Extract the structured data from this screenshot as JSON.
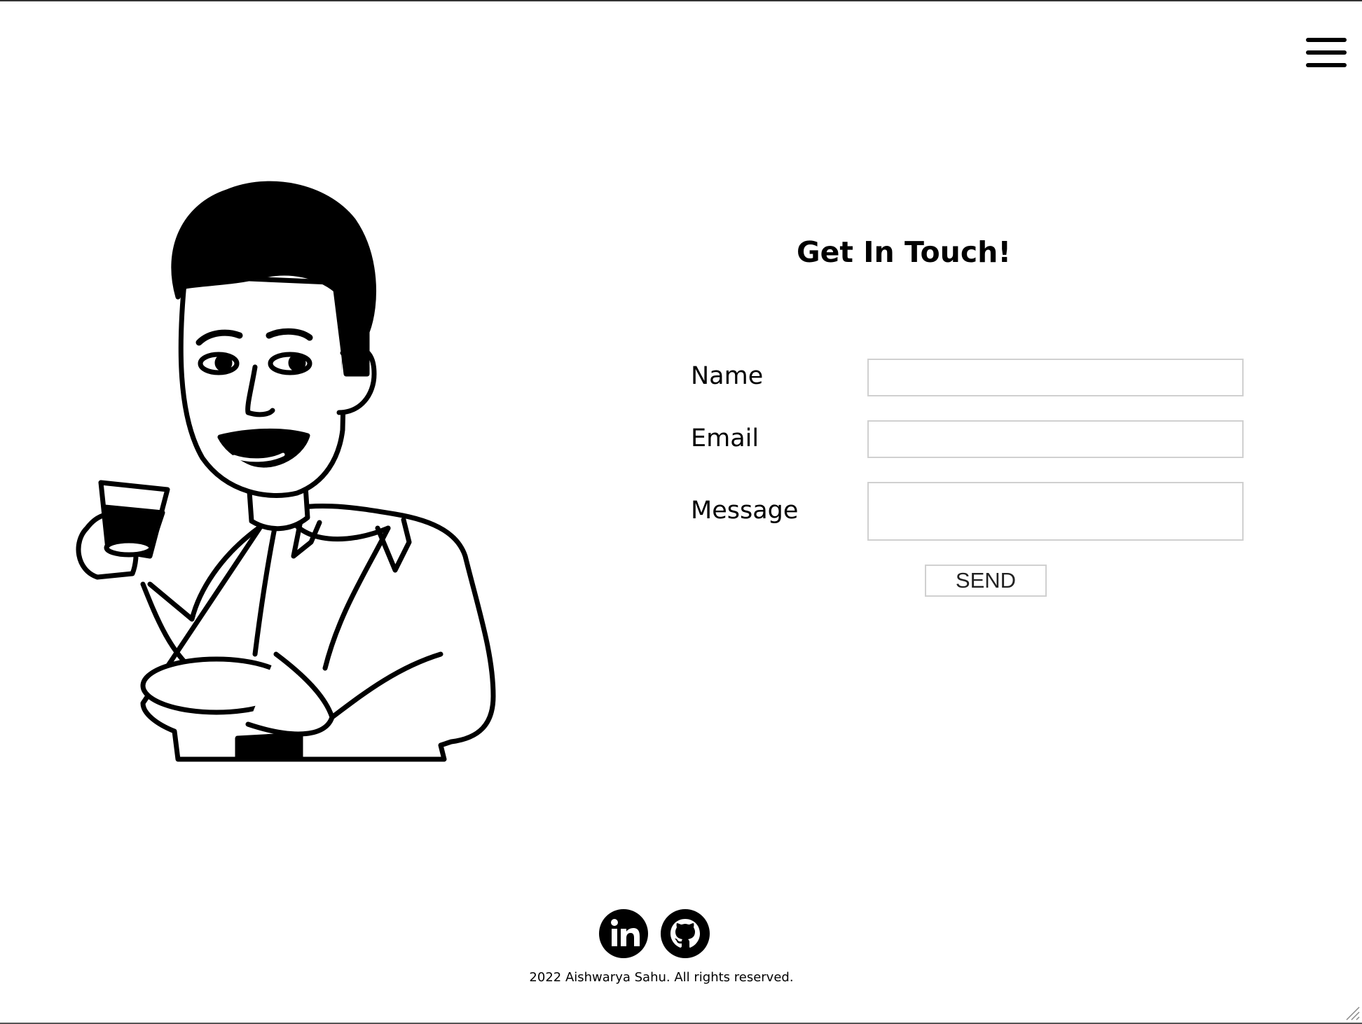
{
  "header": {
    "menu_icon": "hamburger-menu-icon"
  },
  "contact": {
    "title": "Get In Touch!",
    "fields": {
      "name_label": "Name",
      "name_value": "",
      "email_label": "Email",
      "email_value": "",
      "message_label": "Message",
      "message_value": ""
    },
    "send_label": "SEND"
  },
  "illustration": {
    "icon": "bitmoji-avatar-holding-tea-illustration"
  },
  "footer": {
    "social_icons": [
      "linkedin-icon",
      "github-icon"
    ],
    "copyright": "2022 Aishwarya Sahu. All rights reserved."
  }
}
